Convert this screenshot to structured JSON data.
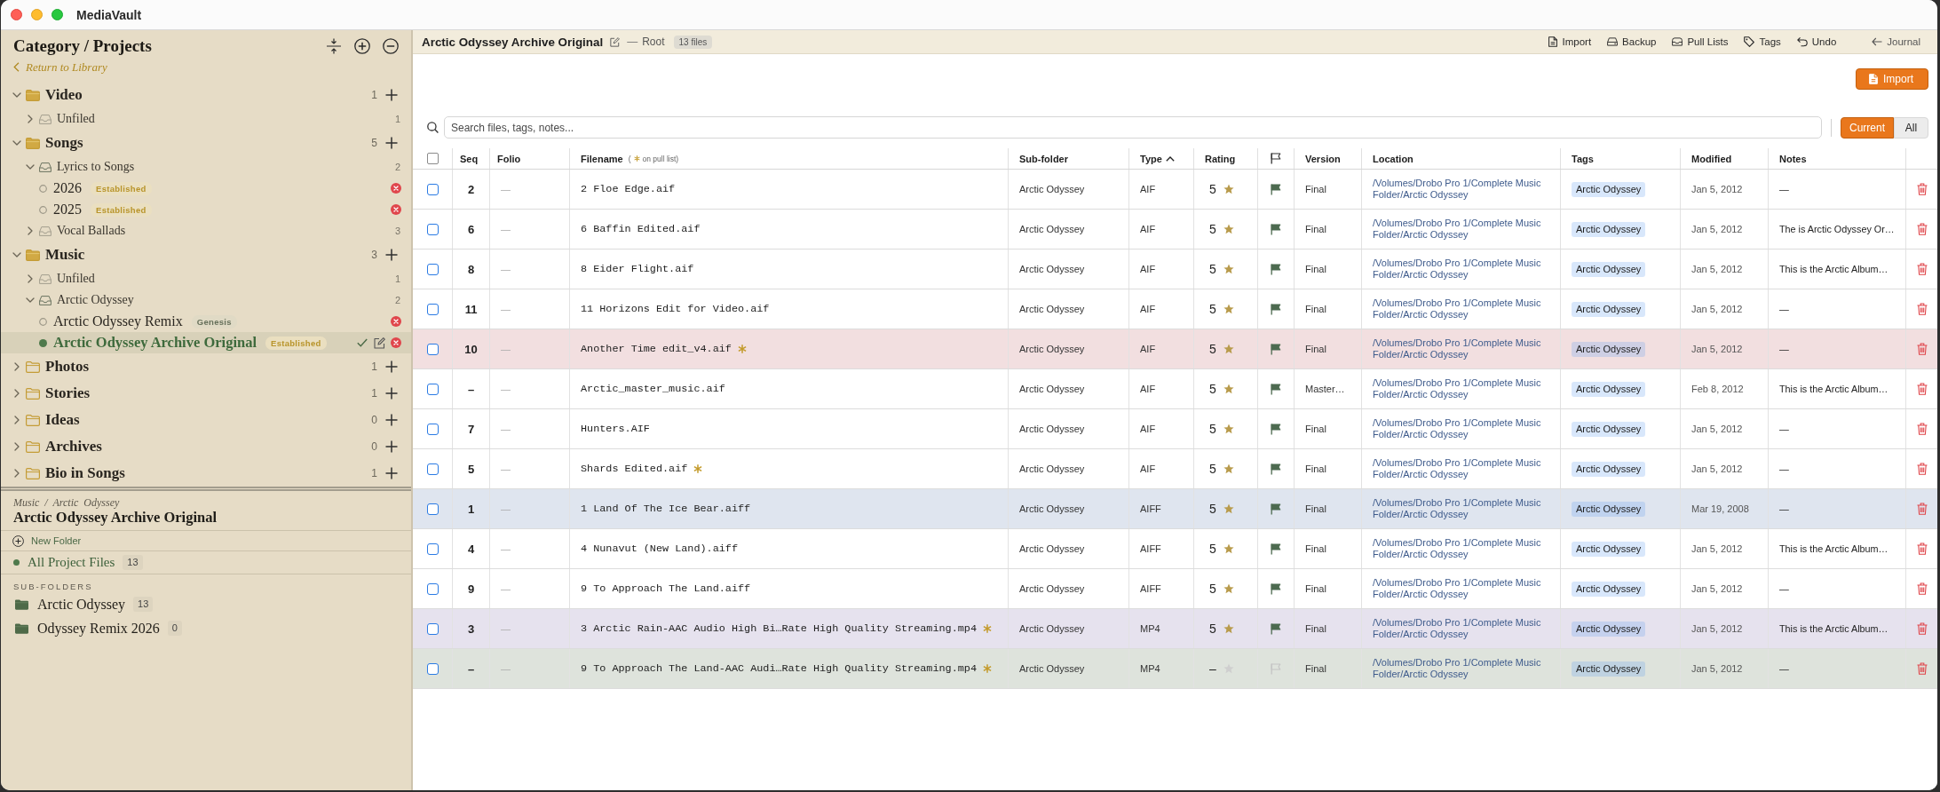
{
  "window": {
    "title": "MediaVault"
  },
  "sidebar": {
    "title": "Category / Projects",
    "back_link": "Return to Library",
    "categories": [
      {
        "kind": "category",
        "name": "Video",
        "count": "1",
        "expanded": true,
        "children": [
          {
            "kind": "group",
            "name": "Unfiled",
            "count": "1",
            "expanded": false
          }
        ]
      },
      {
        "kind": "category",
        "name": "Songs",
        "count": "5",
        "expanded": true,
        "children": [
          {
            "kind": "group",
            "name": "Lyrics to Songs",
            "count": "2",
            "expanded": true,
            "children": [
              {
                "kind": "project",
                "name": "2026",
                "badge": "Established",
                "color": "#b8942a",
                "selected": false
              },
              {
                "kind": "project",
                "name": "2025",
                "badge": "Established",
                "color": "#b8942a",
                "selected": false
              }
            ]
          },
          {
            "kind": "group",
            "name": "Vocal Ballads",
            "count": "3",
            "expanded": false
          }
        ]
      },
      {
        "kind": "category",
        "name": "Music",
        "count": "3",
        "expanded": true,
        "children": [
          {
            "kind": "group",
            "name": "Unfiled",
            "count": "1",
            "expanded": false
          },
          {
            "kind": "group",
            "name": "Arctic Odyssey",
            "count": "2",
            "expanded": true,
            "children": [
              {
                "kind": "project",
                "name": "Arctic Odyssey Remix",
                "badge": "Genesis",
                "color": "#66705a",
                "selected": false
              },
              {
                "kind": "project",
                "name": "Arctic Odyssey Archive Original",
                "badge": "Established",
                "color": "#b8942a",
                "selected": true
              }
            ]
          }
        ]
      },
      {
        "kind": "category",
        "name": "Photos",
        "count": "1",
        "expanded": false
      },
      {
        "kind": "category",
        "name": "Stories",
        "count": "1",
        "expanded": false
      },
      {
        "kind": "category",
        "name": "Ideas",
        "count": "0",
        "expanded": false
      },
      {
        "kind": "category",
        "name": "Archives",
        "count": "0",
        "expanded": false
      },
      {
        "kind": "category",
        "name": "Bio in Songs",
        "count": "1",
        "expanded": false
      }
    ]
  },
  "details": {
    "breadcrumb": "Music / Arctic Odyssey",
    "title": "Arctic Odyssey Archive Original",
    "new_folder": "New Folder",
    "all_files": {
      "label": "All Project Files",
      "count": "13",
      "selected": true
    },
    "subfolders_label": "SUB-FOLDERS",
    "subfolders": [
      {
        "name": "Arctic Odyssey",
        "count": "13"
      },
      {
        "name": "Odyssey Remix 2026",
        "count": "0"
      }
    ]
  },
  "project_bar": {
    "title": "Arctic Odyssey Archive Original",
    "separator": "—",
    "path": "Root",
    "file_count": "13 files",
    "actions": [
      {
        "kind": "import",
        "label": "Import"
      },
      {
        "kind": "backup",
        "label": "Backup"
      },
      {
        "kind": "pull_lists",
        "label": "Pull Lists"
      },
      {
        "kind": "tags",
        "label": "Tags"
      },
      {
        "kind": "undo",
        "label": "Undo"
      },
      {
        "kind": "journal",
        "label": "Journal"
      }
    ]
  },
  "import_button": "Import",
  "search": {
    "placeholder": "Search files, tags, notes..."
  },
  "scope": [
    {
      "label": "Current",
      "selected": true
    },
    {
      "label": "All",
      "selected": false
    }
  ],
  "table": {
    "columns": [
      {
        "kind": "checkbox",
        "checked": false
      },
      {
        "kind": "label",
        "label": "Seq"
      },
      {
        "kind": "label",
        "label": "Folio"
      },
      {
        "kind": "filename",
        "label": "Filename",
        "legend_open": "(",
        "legend_text": "on pull list)"
      },
      {
        "kind": "label",
        "label": "Sub-folder"
      },
      {
        "kind": "label",
        "label": "Type",
        "sorted": true
      },
      {
        "kind": "label",
        "label": "Rating"
      },
      {
        "kind": "flag"
      },
      {
        "kind": "label",
        "label": "Version"
      },
      {
        "kind": "label",
        "label": "Location"
      },
      {
        "kind": "label",
        "label": "Tags"
      },
      {
        "kind": "label",
        "label": "Modified"
      },
      {
        "kind": "label",
        "label": "Notes"
      }
    ],
    "rows": [
      {
        "checked": false,
        "seq": "2",
        "folio": "—",
        "filename": "2 Floe Edge.aif",
        "on_pull_list": false,
        "subfolder": "Arctic Odyssey",
        "type": "AIF",
        "rating": "5",
        "starred": true,
        "flagged": true,
        "version": "Final",
        "location": "/Volumes/Drobo Pro 1/Complete Music Folder/Arctic Odyssey",
        "tags": [
          "Arctic Odyssey"
        ],
        "modified": "Jan 5, 2012",
        "notes": "—"
      },
      {
        "checked": false,
        "seq": "6",
        "folio": "—",
        "filename": "6 Baffin Edited.aif",
        "on_pull_list": false,
        "subfolder": "Arctic Odyssey",
        "type": "AIF",
        "rating": "5",
        "starred": true,
        "flagged": true,
        "version": "Final",
        "location": "/Volumes/Drobo Pro 1/Complete Music Folder/Arctic Odyssey",
        "tags": [
          "Arctic Odyssey"
        ],
        "modified": "Jan 5, 2012",
        "notes": "The is Arctic Odyssey Or…"
      },
      {
        "checked": false,
        "seq": "8",
        "folio": "—",
        "filename": "8 Eider Flight.aif",
        "on_pull_list": false,
        "subfolder": "Arctic Odyssey",
        "type": "AIF",
        "rating": "5",
        "starred": true,
        "flagged": true,
        "version": "Final",
        "location": "/Volumes/Drobo Pro 1/Complete Music Folder/Arctic Odyssey",
        "tags": [
          "Arctic Odyssey"
        ],
        "modified": "Jan 5, 2012",
        "notes": "This is the Arctic Album…"
      },
      {
        "checked": false,
        "seq": "11",
        "folio": "—",
        "filename": "11 Horizons Edit for Video.aif",
        "on_pull_list": false,
        "subfolder": "Arctic Odyssey",
        "type": "AIF",
        "rating": "5",
        "starred": true,
        "flagged": true,
        "version": "Final",
        "location": "/Volumes/Drobo Pro 1/Complete Music Folder/Arctic Odyssey",
        "tags": [
          "Arctic Odyssey"
        ],
        "modified": "Jan 5, 2012",
        "notes": "—"
      },
      {
        "checked": false,
        "seq": "10",
        "folio": "—",
        "filename": "Another Time edit_v4.aif",
        "on_pull_list": true,
        "color": "#f2dfe0",
        "subfolder": "Arctic Odyssey",
        "type": "AIF",
        "rating": "5",
        "starred": true,
        "flagged": true,
        "version": "Final",
        "location": "/Volumes/Drobo Pro 1/Complete Music Folder/Arctic Odyssey",
        "tags": [
          "Arctic Odyssey"
        ],
        "modified": "Jan 5, 2012",
        "notes": "—"
      },
      {
        "checked": false,
        "seq": "–",
        "folio": "—",
        "filename": "Arctic_master_music.aif",
        "on_pull_list": false,
        "subfolder": "Arctic Odyssey",
        "type": "AIF",
        "rating": "5",
        "starred": true,
        "flagged": true,
        "version": "Master…",
        "location": "/Volumes/Drobo Pro 1/Complete Music Folder/Arctic Odyssey",
        "tags": [
          "Arctic Odyssey"
        ],
        "modified": "Feb 8, 2012",
        "notes": "This is the Arctic Album…"
      },
      {
        "checked": false,
        "seq": "7",
        "folio": "—",
        "filename": "Hunters.AIF",
        "on_pull_list": false,
        "subfolder": "Arctic Odyssey",
        "type": "AIF",
        "rating": "5",
        "starred": true,
        "flagged": true,
        "version": "Final",
        "location": "/Volumes/Drobo Pro 1/Complete Music Folder/Arctic Odyssey",
        "tags": [
          "Arctic Odyssey"
        ],
        "modified": "Jan 5, 2012",
        "notes": "—"
      },
      {
        "checked": false,
        "seq": "5",
        "folio": "—",
        "filename": "Shards Edited.aif",
        "on_pull_list": true,
        "subfolder": "Arctic Odyssey",
        "type": "AIF",
        "rating": "5",
        "starred": true,
        "flagged": true,
        "version": "Final",
        "location": "/Volumes/Drobo Pro 1/Complete Music Folder/Arctic Odyssey",
        "tags": [
          "Arctic Odyssey"
        ],
        "modified": "Jan 5, 2012",
        "notes": "—"
      },
      {
        "checked": false,
        "seq": "1",
        "folio": "—",
        "filename": "1 Land Of The Ice Bear.aiff",
        "on_pull_list": false,
        "color": "#dfe5ef",
        "subfolder": "Arctic Odyssey",
        "type": "AIFF",
        "rating": "5",
        "starred": true,
        "flagged": true,
        "version": "Final",
        "location": "/Volumes/Drobo Pro 1/Complete Music Folder/Arctic Odyssey",
        "tags": [
          "Arctic Odyssey"
        ],
        "modified": "Mar 19, 2008",
        "notes": "—"
      },
      {
        "checked": false,
        "seq": "4",
        "folio": "—",
        "filename": "4 Nunavut (New Land).aiff",
        "on_pull_list": false,
        "subfolder": "Arctic Odyssey",
        "type": "AIFF",
        "rating": "5",
        "starred": true,
        "flagged": true,
        "version": "Final",
        "location": "/Volumes/Drobo Pro 1/Complete Music Folder/Arctic Odyssey",
        "tags": [
          "Arctic Odyssey"
        ],
        "modified": "Jan 5, 2012",
        "notes": "This is the Arctic Album…"
      },
      {
        "checked": false,
        "seq": "9",
        "folio": "—",
        "filename": "9 To Approach The Land.aiff",
        "on_pull_list": false,
        "subfolder": "Arctic Odyssey",
        "type": "AIFF",
        "rating": "5",
        "starred": true,
        "flagged": true,
        "version": "Final",
        "location": "/Volumes/Drobo Pro 1/Complete Music Folder/Arctic Odyssey",
        "tags": [
          "Arctic Odyssey"
        ],
        "modified": "Jan 5, 2012",
        "notes": "—"
      },
      {
        "checked": false,
        "seq": "3",
        "folio": "—",
        "filename": "3 Arctic Rain-AAC Audio High Bi…Rate High Quality Streaming.mp4",
        "on_pull_list": true,
        "color": "#e6e2ee",
        "subfolder": "Arctic Odyssey",
        "type": "MP4",
        "rating": "5",
        "starred": true,
        "flagged": true,
        "version": "Final",
        "location": "/Volumes/Drobo Pro 1/Complete Music Folder/Arctic Odyssey",
        "tags": [
          "Arctic Odyssey"
        ],
        "modified": "Jan 5, 2012",
        "notes": "This is the Arctic Album…"
      },
      {
        "checked": false,
        "seq": "–",
        "folio": "—",
        "filename": "9 To Approach The Land-AAC Audi…Rate High Quality Streaming.mp4",
        "on_pull_list": true,
        "color": "#dee3dc",
        "subfolder": "Arctic Odyssey",
        "type": "MP4",
        "rating": "–",
        "starred": false,
        "flagged": false,
        "version": "Final",
        "location": "/Volumes/Drobo Pro 1/Complete Music Folder/Arctic Odyssey",
        "tags": [
          "Arctic Odyssey"
        ],
        "modified": "Jan 5, 2012",
        "notes": "—"
      }
    ]
  }
}
